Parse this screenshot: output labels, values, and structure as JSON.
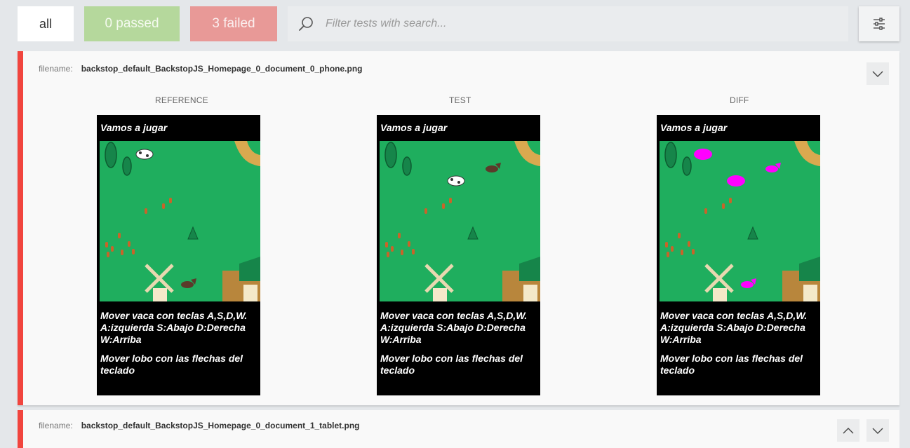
{
  "filters": {
    "all_label": "all",
    "passed_label": "0 passed",
    "failed_label": "3 failed"
  },
  "search": {
    "placeholder": "Filter tests with search..."
  },
  "tests": [
    {
      "filename_label": "filename:",
      "filename": "backstop_default_BackstopJS_Homepage_0_document_0_phone.png",
      "columns": {
        "reference": "REFERENCE",
        "test": "TEST",
        "diff": "DIFF"
      },
      "screenshot": {
        "title": "Vamos a jugar",
        "instructions": "Mover vaca con teclas A,S,D,W. A:izquierda S:Abajo D:Derecha W:Arriba",
        "instructions_wolf": "Mover lobo con las flechas del teclado"
      }
    },
    {
      "filename_label": "filename:",
      "filename": "backstop_default_BackstopJS_Homepage_0_document_1_tablet.png"
    }
  ],
  "colors": {
    "failed": "#f1453e",
    "passed": "#b5d89c",
    "grass": "#1fae5e",
    "diff_highlight": "#ff00ff"
  },
  "icons": [
    "search-icon",
    "settings-sliders-icon",
    "chevron-down-icon",
    "chevron-up-icon"
  ]
}
